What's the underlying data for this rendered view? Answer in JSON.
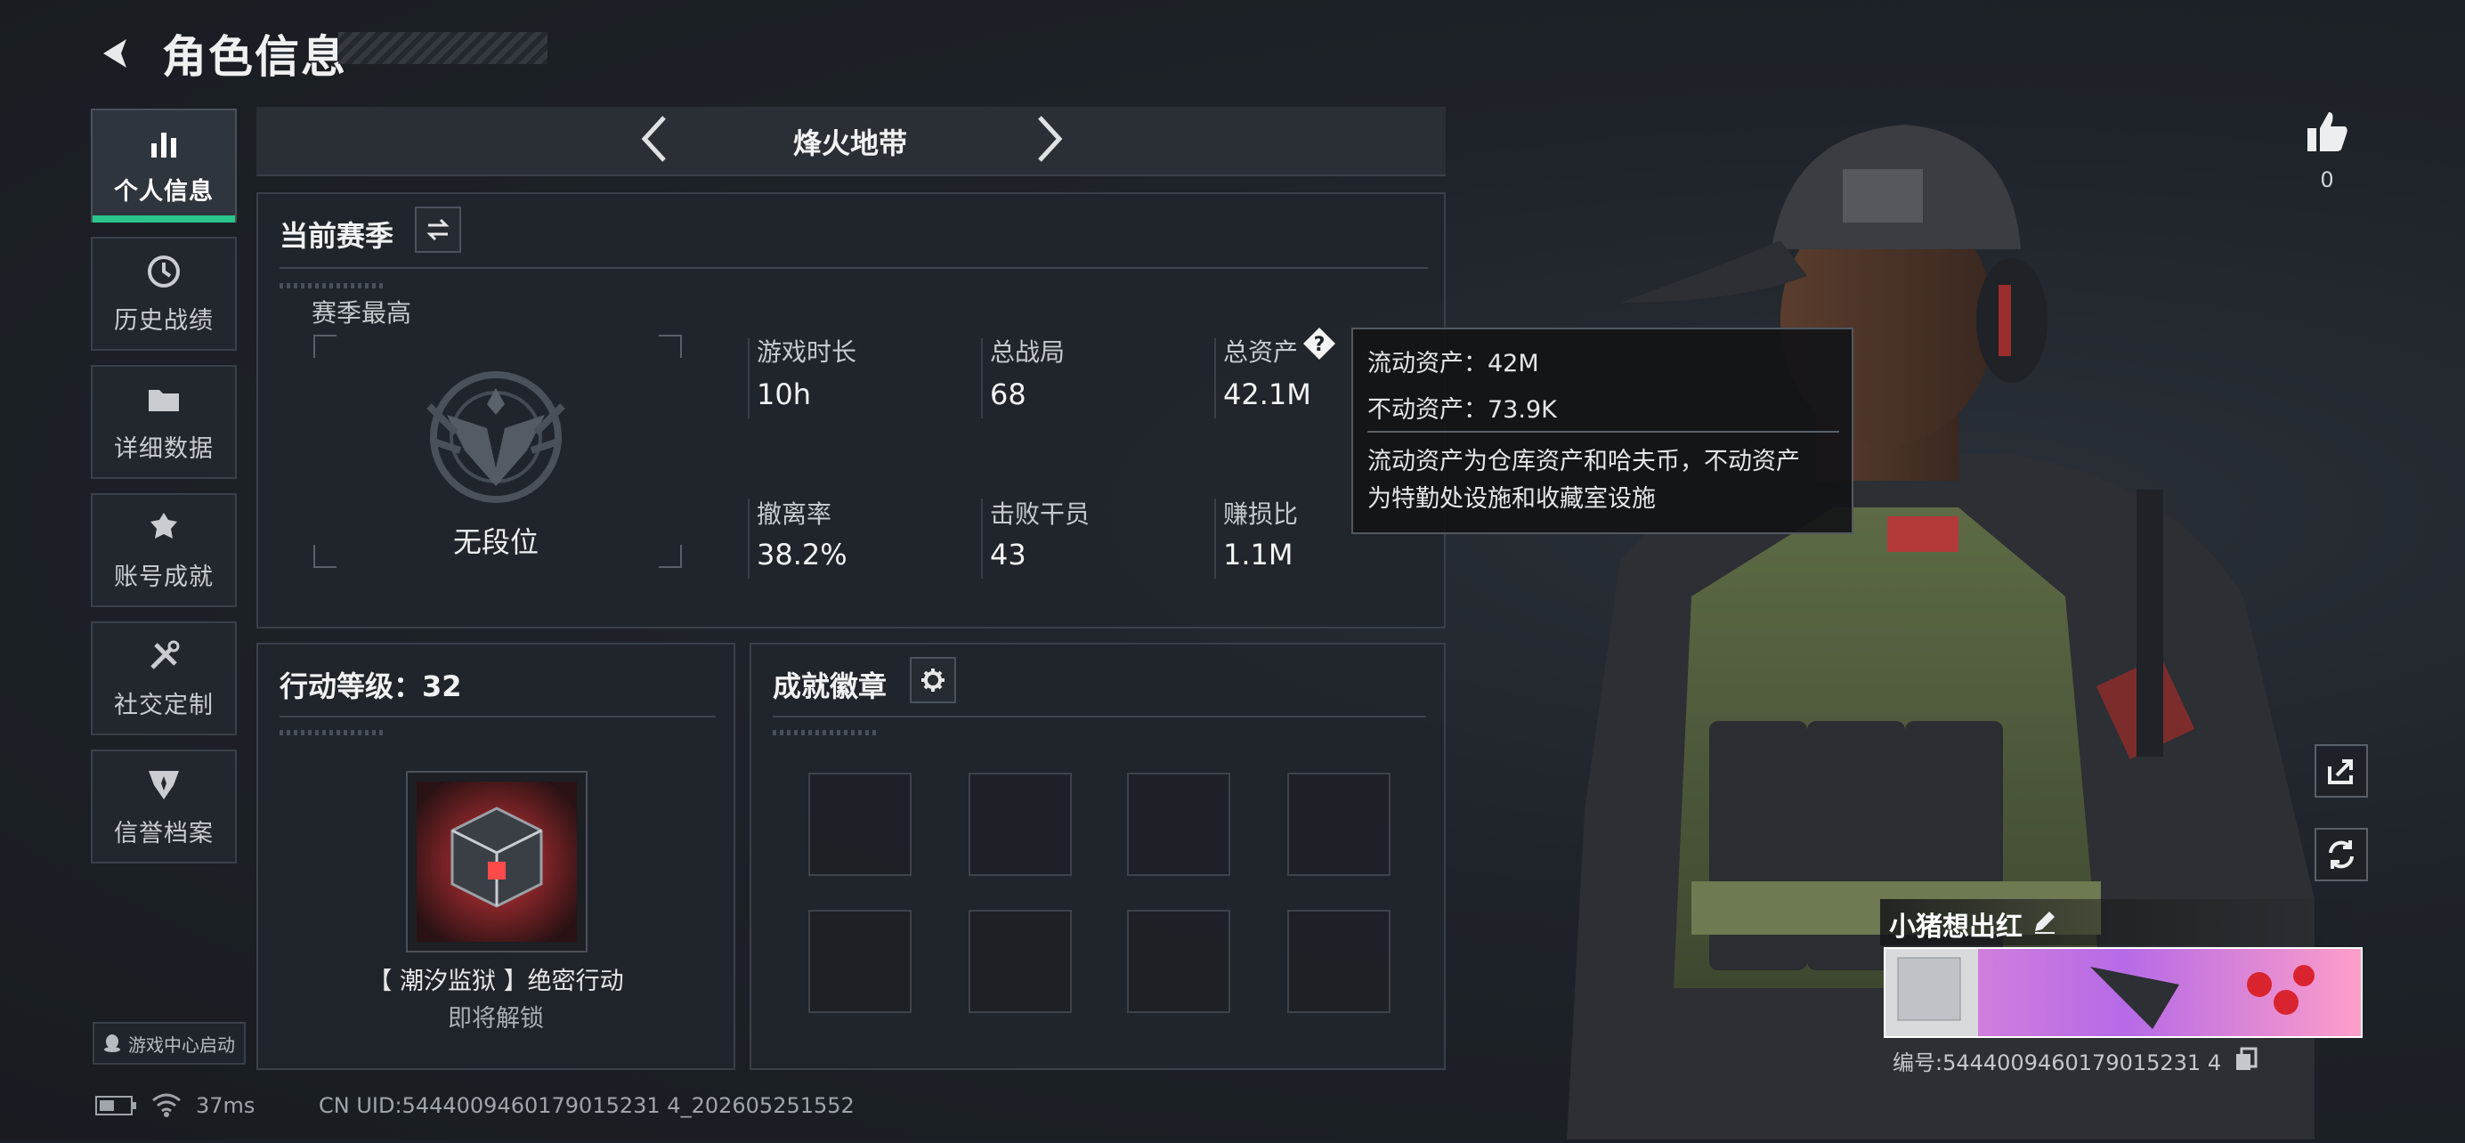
{
  "header": {
    "title": "角色信息"
  },
  "nav": {
    "items": [
      {
        "label": "个人信息",
        "icon": "bar-chart-icon",
        "active": true
      },
      {
        "label": "历史战绩",
        "icon": "history-clock-icon",
        "active": false
      },
      {
        "label": "详细数据",
        "icon": "folder-icon",
        "active": false
      },
      {
        "label": "账号成就",
        "icon": "achievement-medal-icon",
        "active": false
      },
      {
        "label": "社交定制",
        "icon": "tools-icon",
        "active": false
      },
      {
        "label": "信誉档案",
        "icon": "credit-shield-icon",
        "active": false
      }
    ],
    "game_center": "游戏中心启动"
  },
  "mode": {
    "label": "烽火地带"
  },
  "season": {
    "title": "当前赛季",
    "best_label": "赛季最高",
    "rank": "无段位",
    "stats": [
      {
        "label": "游戏时长",
        "value": "10h"
      },
      {
        "label": "总战局",
        "value": "68"
      },
      {
        "label": "总资产",
        "value": "42.1M"
      },
      {
        "label": "撤离率",
        "value": "38.2%"
      },
      {
        "label": "击败干员",
        "value": "43"
      },
      {
        "label": "赚损比",
        "value": "1.1M"
      }
    ]
  },
  "tooltip": {
    "liquid": "流动资产：42M",
    "fixed": "不动资产：73.9K",
    "desc1": "流动资产为仓库资产和哈夫币，不动资产",
    "desc2": "为特勤处设施和收藏室设施"
  },
  "action": {
    "title": "行动等级：32",
    "reward_name": "【 潮汐监狱 】绝密行动",
    "reward_status": "即将解锁"
  },
  "badges": {
    "title": "成就徽章",
    "slot_count": 8
  },
  "profile": {
    "likes": "0",
    "name": "小猪想出红",
    "id_text": "编号:5444009460179015231 4"
  },
  "footer": {
    "ping": "37ms",
    "uid": "CN UID:5444009460179015231 4_202605251552"
  },
  "colors": {
    "accent": "#29c58b",
    "panel_border": "#3a4048",
    "background": "#1b2026"
  }
}
